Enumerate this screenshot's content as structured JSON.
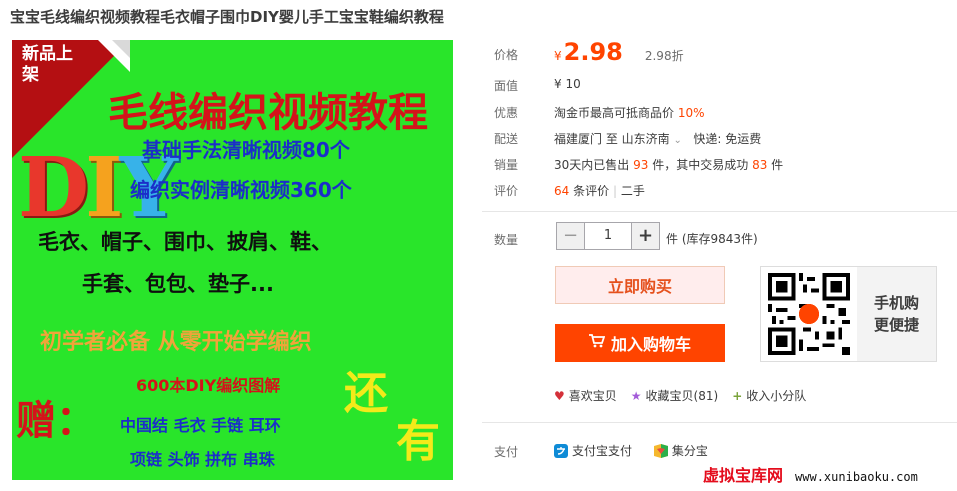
{
  "title": "宝宝毛线编织视频教程毛衣帽子围巾DIY婴儿手工宝宝鞋编织教程",
  "poster": {
    "corner_label": "新品上架",
    "headline": "毛线编织视频教程",
    "diy": "DIY",
    "line1": "基础手法清晰视频80个",
    "line2": "编织实例清晰视频360个",
    "line3": "毛衣、帽子、围巾、披肩、鞋、",
    "line4": "手套、包包、垫子...",
    "line5": "初学者必备  从零开始学编织",
    "line6": "600本DIY编织图解",
    "gift": "赠：",
    "gift_row1": "中国结  毛衣  手链  耳环",
    "gift_row2": "项链  头饰  拼布  串珠",
    "also": "还",
    "also2": "有"
  },
  "price": {
    "label": "价格",
    "symbol": "¥",
    "value": "2.98",
    "discount": "2.98折"
  },
  "face_value": {
    "label": "面值",
    "value": "¥ 10"
  },
  "promo": {
    "label": "优惠",
    "text": "淘金币最高可抵商品价",
    "percent": "10%"
  },
  "shipping": {
    "label": "配送",
    "from": "福建厦门 至",
    "to": "山东济南",
    "method": "快递: 免运费"
  },
  "sales": {
    "label": "销量",
    "prefix": "30天内已售出",
    "sold": "93",
    "mid": "件，其中交易成功",
    "success": "83",
    "suffix": "件"
  },
  "reviews": {
    "label": "评价",
    "count": "64",
    "unit": "条评价",
    "condition": "二手"
  },
  "quantity": {
    "label": "数量",
    "minus": "−",
    "value": "1",
    "plus": "+",
    "stock": "件 (库存9843件)"
  },
  "buttons": {
    "buy_now": "立即购买",
    "add_cart": "加入购物车"
  },
  "mobile": {
    "line1": "手机购",
    "line2": "更便捷",
    "qr_badge": "淘"
  },
  "actions": {
    "like": "喜欢宝贝",
    "favorite": "收藏宝贝(81)",
    "collect": "收入小分队"
  },
  "payment": {
    "label": "支付",
    "alipay": "支付宝支付",
    "jifenbao": "集分宝"
  },
  "watermark": {
    "name": "虚拟宝库网",
    "url": "www.xunibaoku.com"
  },
  "colors": {
    "accent": "#ff4400",
    "poster_bg": "#29e52a"
  }
}
